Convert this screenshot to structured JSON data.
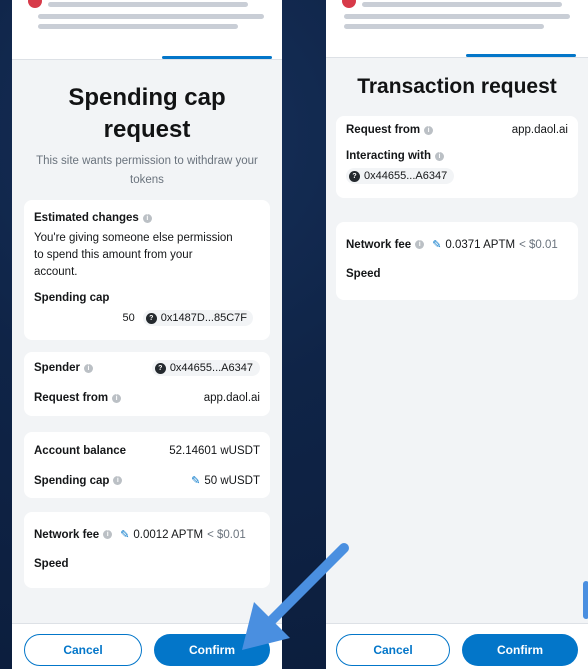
{
  "left": {
    "title_line1": "Spending cap",
    "title_line2": "request",
    "subtitle_line1": "This site wants permission to withdraw your",
    "subtitle_line2": "tokens",
    "estimated": {
      "label": "Estimated changes",
      "text_line1": "You're giving someone else permission",
      "text_line2": "to spend this amount from your",
      "text_line3": "account.",
      "spending_cap_label": "Spending cap",
      "amount": "50",
      "token_address": "0x1487D...85C7F"
    },
    "spender_label": "Spender",
    "spender_address": "0x44655...A6347",
    "request_from_label": "Request from",
    "request_from_value": "app.daol.ai",
    "account_balance_label": "Account balance",
    "account_balance_value": "52.14601 wUSDT",
    "spending_cap_label": "Spending cap",
    "spending_cap_value": "50 wUSDT",
    "network_fee_label": "Network fee",
    "network_fee_value": "0.0012 APTM",
    "network_fee_fiat": "< $0.01",
    "speed_label": "Speed",
    "cancel_label": "Cancel",
    "confirm_label": "Confirm"
  },
  "right": {
    "title": "Transaction request",
    "request_from_label": "Request from",
    "request_from_value": "app.daol.ai",
    "interacting_with_label": "Interacting with",
    "interacting_with_address": "0x44655...A6347",
    "network_fee_label": "Network fee",
    "network_fee_value": "0.0371 APTM",
    "network_fee_fiat": "< $0.01",
    "speed_label": "Speed",
    "cancel_label": "Cancel",
    "confirm_label": "Confirm"
  },
  "colors": {
    "background": "#0f2447",
    "primary": "#0376c9",
    "arrow": "#4a8fe0"
  },
  "icons": {
    "info": "info-icon",
    "token": "token-icon",
    "edit": "edit-pencil-icon",
    "arrow": "pointer-arrow-icon"
  }
}
